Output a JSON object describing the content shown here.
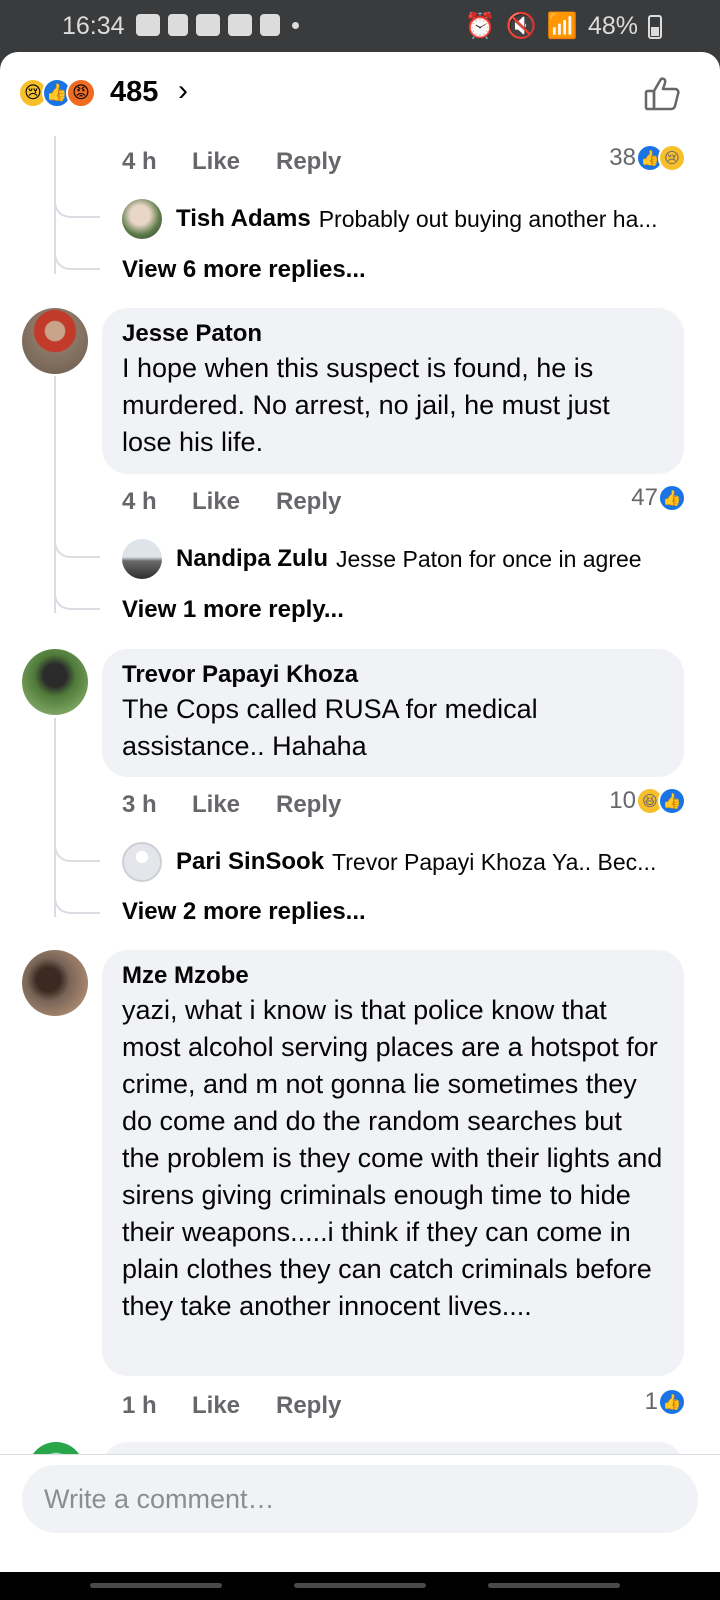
{
  "status_bar": {
    "time": "16:34",
    "battery": "48%"
  },
  "header": {
    "reaction_count": "485",
    "reactions": [
      "sad",
      "like",
      "angry"
    ]
  },
  "comments": [
    {
      "time": "4 h",
      "like_label": "Like",
      "reply_label": "Reply",
      "reaction_count": "38",
      "reactions": [
        "like",
        "sad"
      ],
      "reply_preview": {
        "name": "Tish Adams",
        "text": "Probably out buying another ha..."
      },
      "more_replies": "View 6 more replies..."
    },
    {
      "name": "Jesse Paton",
      "text": "I hope when this suspect is found, he is murdered. No arrest, no jail, he must just lose his life.",
      "time": "4 h",
      "like_label": "Like",
      "reply_label": "Reply",
      "reaction_count": "47",
      "reactions": [
        "like"
      ],
      "reply_preview": {
        "name": "Nandipa Zulu",
        "text": "Jesse Paton for once in agree"
      },
      "more_replies": "View 1 more reply..."
    },
    {
      "name": "Trevor Papayi Khoza",
      "text": "The Cops called RUSA for medical assistance.. Hahaha",
      "time": "3 h",
      "like_label": "Like",
      "reply_label": "Reply",
      "reaction_count": "10",
      "reactions": [
        "haha",
        "like"
      ],
      "reply_preview": {
        "name": "Pari SinSook",
        "text": "Trevor Papayi Khoza Ya.. Bec..."
      },
      "more_replies": "View 2 more replies..."
    },
    {
      "name": "Mze Mzobe",
      "text": "yazi, what i know is that police know that most alcohol serving places are a hotspot for crime, and m not gonna lie sometimes they do come and do the random searches but the problem is they come with their lights and sirens giving criminals enough time to hide their weapons.....i think if they can come in plain clothes they can catch criminals before they take another innocent lives....",
      "time": "1 h",
      "like_label": "Like",
      "reply_label": "Reply",
      "reaction_count": "1",
      "reactions": [
        "like"
      ]
    }
  ],
  "composer": {
    "placeholder": "Write a comment…"
  },
  "colors": {
    "accent": "#1b74e4",
    "bubble": "#f0f2f5",
    "muted": "#65676b"
  }
}
